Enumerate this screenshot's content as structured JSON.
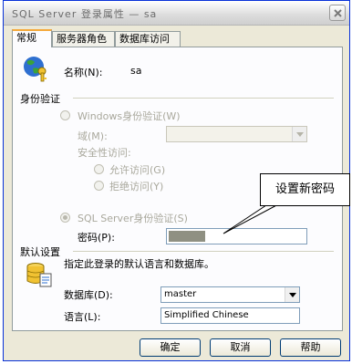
{
  "window": {
    "title": "SQL Server 登录属性 — sa"
  },
  "tabs": [
    {
      "label": "常规"
    },
    {
      "label": "服务器角色"
    },
    {
      "label": "数据库访问"
    }
  ],
  "general": {
    "name_label": "名称(N):",
    "name_value": "sa"
  },
  "auth": {
    "section_title": "身份验证",
    "windows_option": "Windows身份验证(W)",
    "domain_label": "域(M):",
    "security_access_label": "安全性访问:",
    "allow_option": "允许访问(G)",
    "deny_option": "拒绝访问(Y)",
    "sql_option": "SQL Server身份验证(S)",
    "password_label": "密码(P):",
    "password_value": "••••••••"
  },
  "callout": {
    "text": "设置新密码"
  },
  "defaults": {
    "section_title": "默认设置",
    "description": "指定此登录的默认语言和数据库。",
    "database_label": "数据库(D):",
    "database_value": "master",
    "language_label": "语言(L):",
    "language_value": "Simplified Chinese"
  },
  "buttons": {
    "ok": "确定",
    "cancel": "取消",
    "help": "帮助"
  }
}
